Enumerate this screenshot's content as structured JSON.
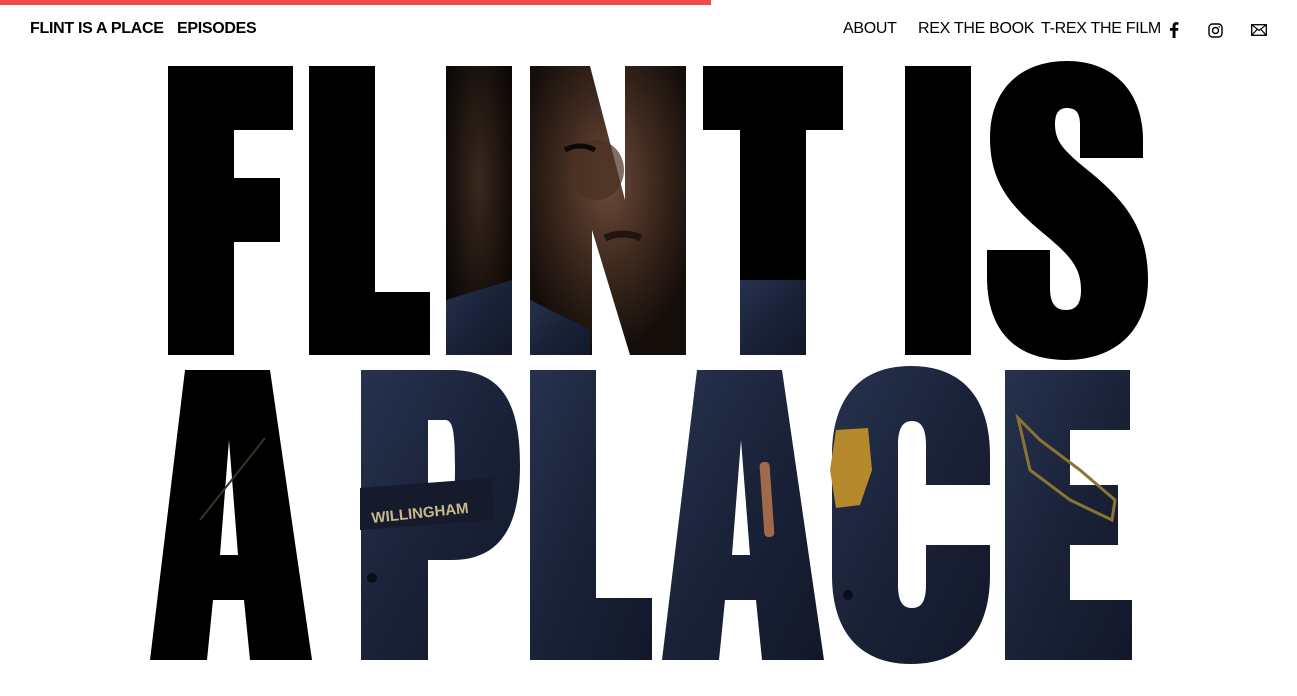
{
  "nav": {
    "brand": "FLINT IS A PLACE",
    "episodes": "EPISODES",
    "about": "ABOUT",
    "rex_book": "REX THE BOOK",
    "trex_film": "T-REX THE FILM",
    "icons": [
      "facebook-icon",
      "instagram-icon",
      "mail-icon"
    ]
  },
  "hero": {
    "line1": "FLINT IS",
    "line2": "A PLACE",
    "badge_text": "WILLINGHAM"
  },
  "colors": {
    "accent": "#f04a4a",
    "text": "#000000",
    "uniform": "#1d2740"
  },
  "progress": 0.55
}
